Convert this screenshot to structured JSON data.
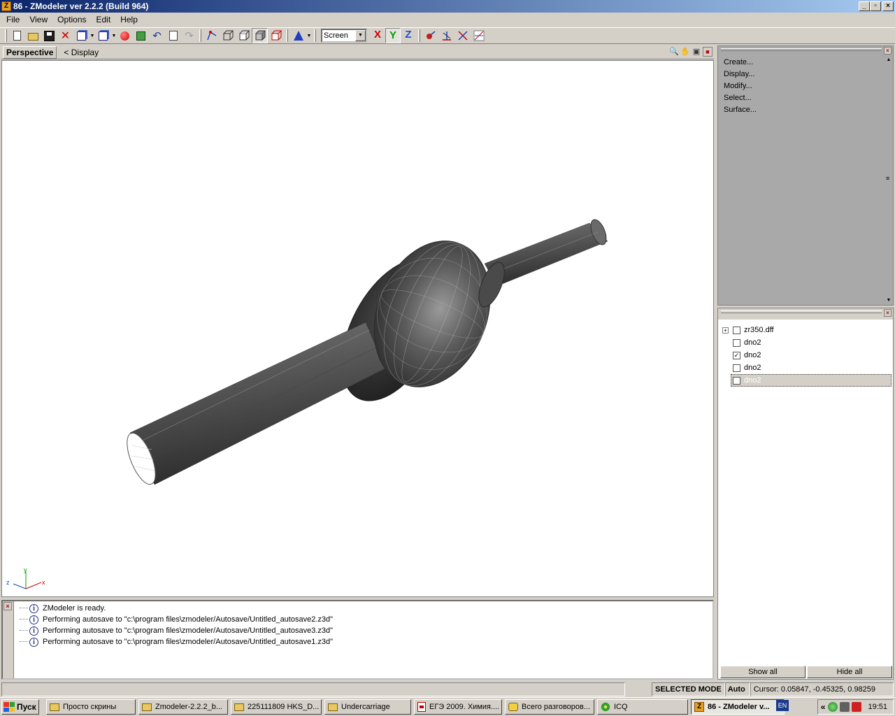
{
  "window": {
    "icon_letter": "Z",
    "title": "86 - ZModeler ver 2.2.2 (Build 964)",
    "btn_min": "_",
    "btn_max": "▫",
    "btn_close": "×"
  },
  "menu": [
    "File",
    "View",
    "Options",
    "Edit",
    "Help"
  ],
  "toolbar": {
    "coord_mode_value": "Screen",
    "axis_x": "X",
    "axis_y": "Y",
    "axis_z": "Z",
    "dropdown_arrow": "▼"
  },
  "viewport": {
    "tab": "Perspective",
    "display_label": "<  Display",
    "axis_gizmo": {
      "x": "x",
      "y": "y",
      "z": "z"
    },
    "colors": {
      "background": "#ffffff",
      "mesh": "#505050",
      "wire": "#c8c8c8"
    }
  },
  "log": {
    "lines": [
      "ZModeler is ready.",
      "Performing autosave to \"c:\\program files\\zmodeler/Autosave/Untitled_autosave2.z3d\"",
      "Performing autosave to \"c:\\program files\\zmodeler/Autosave/Untitled_autosave3.z3d\"",
      "Performing autosave to \"c:\\program files\\zmodeler/Autosave/Untitled_autosave1.z3d\""
    ]
  },
  "command_panel": {
    "items": [
      "Create...",
      "Display...",
      "Modify...",
      "Select...",
      "Surface..."
    ]
  },
  "object_tree": {
    "items": [
      {
        "label": "zr350.dff",
        "checked": false,
        "expandable": true,
        "selected": false
      },
      {
        "label": "dno2",
        "checked": false,
        "expandable": false,
        "selected": false
      },
      {
        "label": "dno2",
        "checked": true,
        "expandable": false,
        "selected": false
      },
      {
        "label": "dno2",
        "checked": false,
        "expandable": false,
        "selected": false
      },
      {
        "label": "dno2",
        "checked": true,
        "expandable": false,
        "selected": true
      }
    ],
    "show_all": "Show all",
    "hide_all": "Hide all"
  },
  "status": {
    "mode": "SELECTED MODE",
    "auto": "Auto",
    "cursor": "Cursor: 0.05847, -0.45325, 0.98259"
  },
  "taskbar": {
    "start": "Пуск",
    "tasks": [
      {
        "label": "Просто скрины",
        "icon": "folder"
      },
      {
        "label": "Zmodeler-2.2.2_b...",
        "icon": "folder"
      },
      {
        "label": "225111809 HKS_D...",
        "icon": "folder"
      },
      {
        "label": "Undercarriage",
        "icon": "folder"
      },
      {
        "label": "ЕГЭ 2009. Химия....",
        "icon": "pdf"
      },
      {
        "label": "Всего разговоров...",
        "icon": "chat"
      },
      {
        "label": "ICQ",
        "icon": "icq"
      },
      {
        "label": "86 - ZModeler v...",
        "icon": "zmodeler",
        "active": true
      }
    ],
    "lang": "EN",
    "tray_arrow": "«",
    "clock": "19:51"
  }
}
